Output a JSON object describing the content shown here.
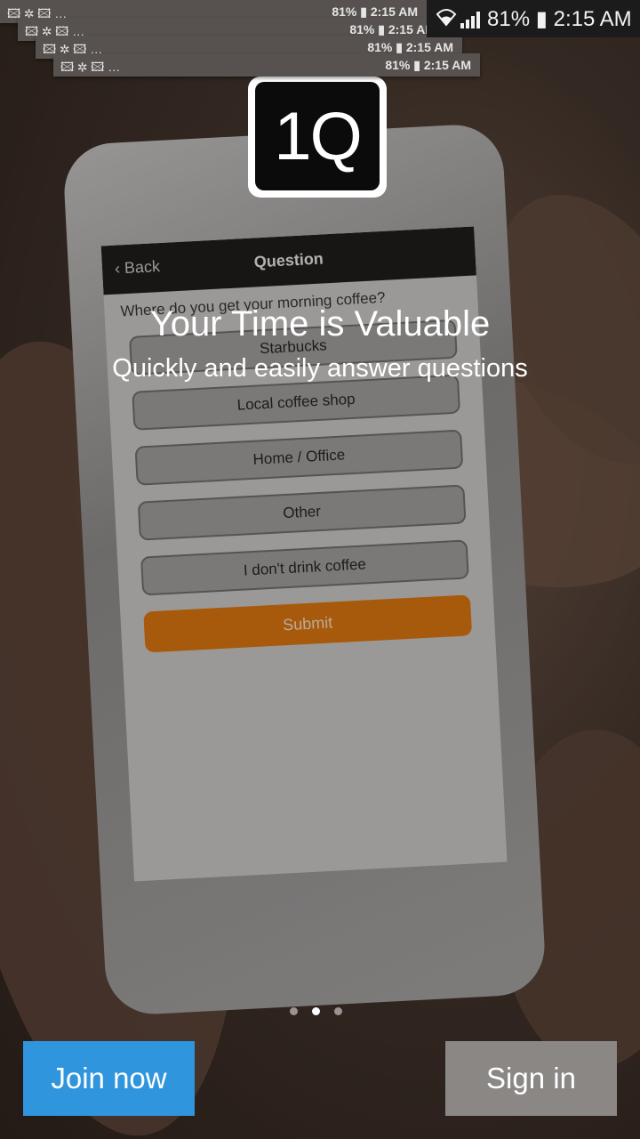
{
  "status_bar": {
    "battery": "81%",
    "time": "2:15 AM"
  },
  "notification_ghosts": [
    {
      "icons": "🖾 ✲ 🖾  …",
      "status": "81% ▮ 2:15 AM"
    },
    {
      "icons": "🖾 ✲ 🖾  …",
      "status": "81% ▮ 2:15 AM"
    },
    {
      "icons": "🖾 ✲ 🖾  …",
      "status": "81% ▮ 2:15 AM"
    },
    {
      "icons": "🖾 ✲ 🖾  …",
      "status": "81% ▮ 2:15 AM"
    }
  ],
  "logo": {
    "text": "1Q"
  },
  "phone_mock": {
    "nav_back": "Back",
    "nav_title": "Question",
    "question": "Where do you get your morning coffee?",
    "options": [
      "Starbucks",
      "Local coffee shop",
      "Home / Office",
      "Other",
      "I don't drink coffee"
    ],
    "submit": "Submit"
  },
  "hero": {
    "title": "Your Time is Valuable",
    "subtitle": "Quickly and easily answer questions"
  },
  "pager": {
    "count": 3,
    "active": 1
  },
  "buttons": {
    "join": "Join now",
    "sign_in": "Sign in"
  },
  "colors": {
    "join": "#2f95dd",
    "sign_in": "#8a8785",
    "submit": "#e0780c"
  }
}
